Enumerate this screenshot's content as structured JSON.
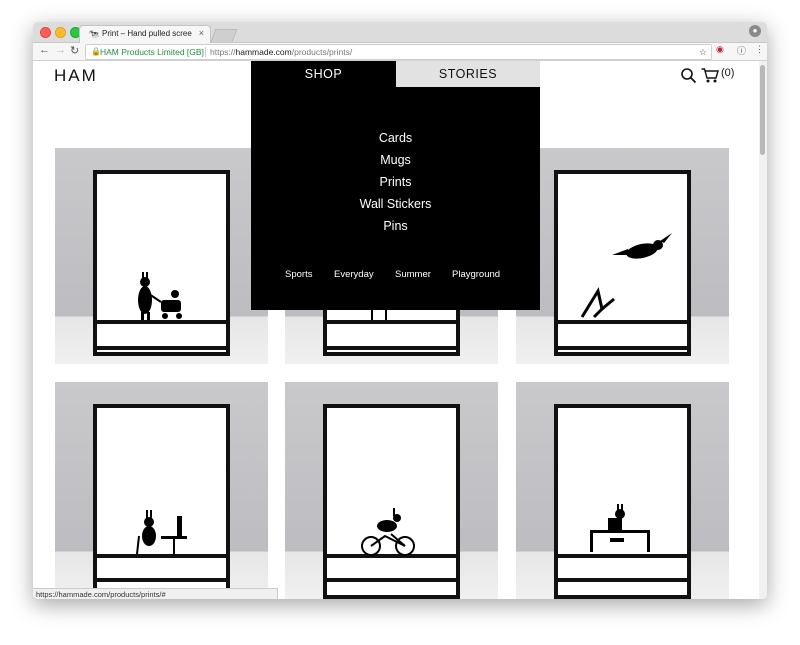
{
  "browser": {
    "tab_title": "Print – Hand pulled screen pri",
    "tab_favicon": "🐄",
    "tab_close": "×",
    "ev_label": "HAM Products Limited [GB]",
    "url_scheme": "https://",
    "url_host": "hammade.com",
    "url_path": "/products/prints/",
    "status_url": "https://hammade.com/products/prints/#"
  },
  "header": {
    "logo": "HAM",
    "cart_count": "(0)"
  },
  "menu": {
    "tabs": [
      "SHOP",
      "STORIES"
    ],
    "items": [
      "Cards",
      "Mugs",
      "Prints",
      "Wall Stickers",
      "Pins"
    ],
    "sub_items": [
      "Sports",
      "Everyday",
      "Summer",
      "Playground"
    ]
  },
  "products": [
    {
      "name": "rabbit-with-pram-print"
    },
    {
      "name": "rabbit-at-desk-print"
    },
    {
      "name": "leaping-rabbit-print"
    },
    {
      "name": "rabbit-drinking-wine-print"
    },
    {
      "name": "rabbit-on-bicycle-print"
    },
    {
      "name": "rabbit-at-computer-print"
    }
  ],
  "icons": {
    "search": "search-icon",
    "cart": "cart-icon",
    "lock": "lock-icon",
    "star": "star-icon"
  },
  "colors": {
    "menu_bg": "#000000",
    "menu_tab_inactive": "#e2e2e2",
    "secure_green": "#1e8e3e"
  }
}
